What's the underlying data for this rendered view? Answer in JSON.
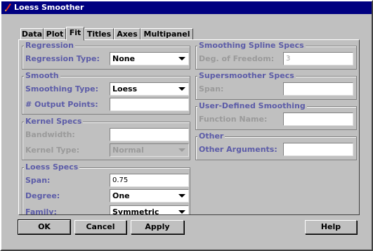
{
  "window": {
    "title": "Loess Smoother"
  },
  "tabs": [
    "Data",
    "Plot",
    "Fit",
    "Titles",
    "Axes",
    "Multipanel"
  ],
  "active_tab": "Fit",
  "regression": {
    "title": "Regression",
    "type_label": "Regression Type:",
    "type_value": "None"
  },
  "smooth": {
    "title": "Smooth",
    "type_label": "Smoothing Type:",
    "type_value": "Loess",
    "points_label": "# Output Points:",
    "points_value": ""
  },
  "kernel": {
    "title": "Kernel Specs",
    "bandwidth_label": "Bandwidth:",
    "bandwidth_value": "",
    "type_label": "Kernel Type:",
    "type_value": "Normal"
  },
  "loess": {
    "title": "Loess Specs",
    "span_label": "Span:",
    "span_value": "0.75",
    "degree_label": "Degree:",
    "degree_value": "One",
    "family_label": "Family:",
    "family_value": "Symmetric"
  },
  "spline": {
    "title": "Smoothing Spline Specs",
    "dof_label": "Deg. of Freedom:",
    "dof_value": "3"
  },
  "supersmoother": {
    "title": "Supersmoother Specs",
    "span_label": "Span:",
    "span_value": ""
  },
  "user_defined": {
    "title": "User-Defined Smoothing",
    "function_label": "Function Name:",
    "function_value": ""
  },
  "other": {
    "title": "Other",
    "args_label": "Other Arguments:",
    "args_value": ""
  },
  "buttons": {
    "ok": "OK",
    "cancel": "Cancel",
    "apply": "Apply",
    "help": "Help"
  },
  "colors": {
    "titlebar": "#000080",
    "section_label": "#5c5ca8",
    "disabled": "#9a9a9a",
    "face": "#c0c0c0"
  }
}
